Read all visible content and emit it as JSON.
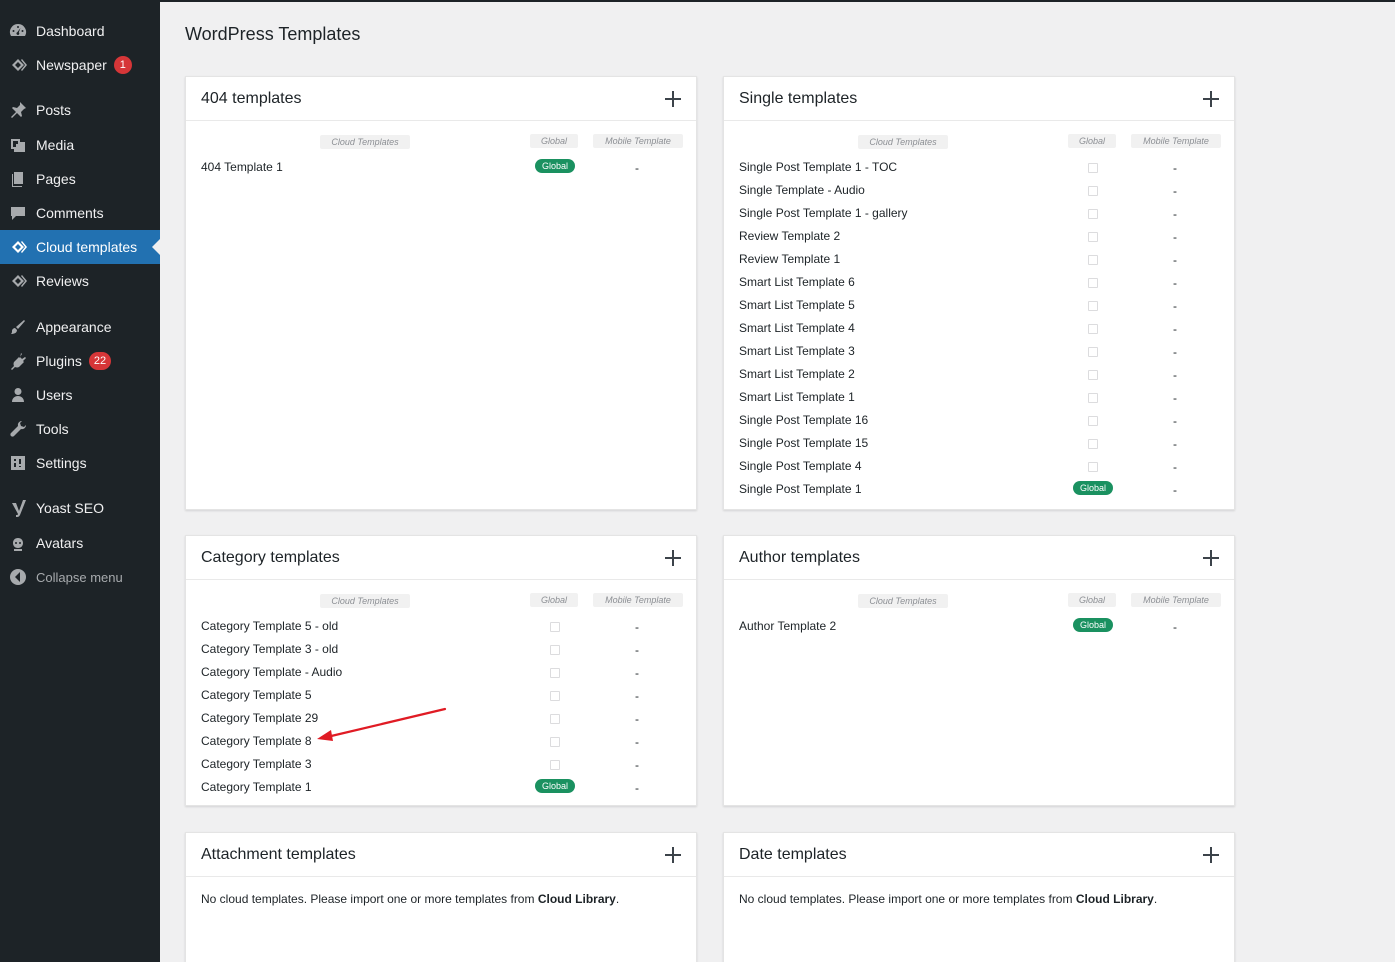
{
  "sidebar": {
    "items": [
      {
        "label": "Dashboard",
        "icon": "dashboard-icon",
        "badge": ""
      },
      {
        "label": "Newspaper",
        "icon": "newspaper-icon",
        "badge": "1"
      },
      {
        "label": "Posts",
        "icon": "pin-icon",
        "badge": ""
      },
      {
        "label": "Media",
        "icon": "media-icon",
        "badge": ""
      },
      {
        "label": "Pages",
        "icon": "pages-icon",
        "badge": ""
      },
      {
        "label": "Comments",
        "icon": "comments-icon",
        "badge": ""
      },
      {
        "label": "Cloud templates",
        "icon": "cloud-templates-icon",
        "badge": "",
        "active": true
      },
      {
        "label": "Reviews",
        "icon": "reviews-icon",
        "badge": ""
      },
      {
        "label": "Appearance",
        "icon": "brush-icon",
        "badge": ""
      },
      {
        "label": "Plugins",
        "icon": "plugin-icon",
        "badge": "22"
      },
      {
        "label": "Users",
        "icon": "user-icon",
        "badge": ""
      },
      {
        "label": "Tools",
        "icon": "wrench-icon",
        "badge": ""
      },
      {
        "label": "Settings",
        "icon": "settings-icon",
        "badge": ""
      },
      {
        "label": "Yoast SEO",
        "icon": "yoast-icon",
        "badge": ""
      },
      {
        "label": "Avatars",
        "icon": "avatar-icon",
        "badge": ""
      },
      {
        "label": "Collapse menu",
        "icon": "collapse-icon",
        "badge": ""
      }
    ]
  },
  "page": {
    "title": "WordPress Templates"
  },
  "columns": {
    "cloud": "Cloud Templates",
    "global": "Global",
    "mobile": "Mobile Template"
  },
  "global_label": "Global",
  "dash": "-",
  "empty_message": {
    "prefix": "No cloud templates. Please import one or more templates from ",
    "link": "Cloud Library",
    "suffix": "."
  },
  "panels": {
    "p404": {
      "title": "404 templates",
      "rows": [
        {
          "name": "404 Template 1",
          "global": true
        }
      ]
    },
    "single": {
      "title": "Single templates",
      "rows": [
        {
          "name": "Single Post Template 1 - TOC",
          "global": false
        },
        {
          "name": "Single Template - Audio",
          "global": false
        },
        {
          "name": "Single Post Template 1 - gallery",
          "global": false
        },
        {
          "name": "Review Template 2",
          "global": false
        },
        {
          "name": "Review Template 1",
          "global": false
        },
        {
          "name": "Smart List Template 6",
          "global": false
        },
        {
          "name": "Smart List Template 5",
          "global": false
        },
        {
          "name": "Smart List Template 4",
          "global": false
        },
        {
          "name": "Smart List Template 3",
          "global": false
        },
        {
          "name": "Smart List Template 2",
          "global": false
        },
        {
          "name": "Smart List Template 1",
          "global": false
        },
        {
          "name": "Single Post Template 16",
          "global": false
        },
        {
          "name": "Single Post Template 15",
          "global": false
        },
        {
          "name": "Single Post Template 4",
          "global": false
        },
        {
          "name": "Single Post Template 1",
          "global": true
        }
      ]
    },
    "category": {
      "title": "Category templates",
      "rows": [
        {
          "name": "Category Template 5 - old",
          "global": false
        },
        {
          "name": "Category Template 3 - old",
          "global": false
        },
        {
          "name": "Category Template - Audio",
          "global": false
        },
        {
          "name": "Category Template 5",
          "global": false
        },
        {
          "name": "Category Template 29",
          "global": false
        },
        {
          "name": "Category Template 8",
          "global": false
        },
        {
          "name": "Category Template 3",
          "global": false
        },
        {
          "name": "Category Template 1",
          "global": true
        }
      ]
    },
    "author": {
      "title": "Author templates",
      "rows": [
        {
          "name": "Author Template 2",
          "global": true
        }
      ]
    },
    "attachment": {
      "title": "Attachment templates",
      "rows": []
    },
    "date": {
      "title": "Date templates",
      "rows": []
    }
  },
  "colors": {
    "sidebar_bg": "#1d2327",
    "active_bg": "#2271b1",
    "global_badge": "#1a9160",
    "notice_badge": "#d63638",
    "arrow": "#e01b24"
  }
}
